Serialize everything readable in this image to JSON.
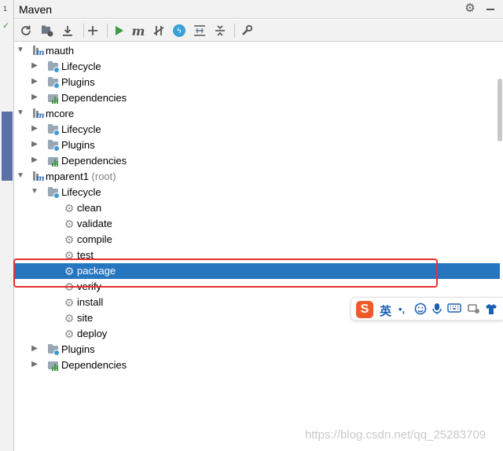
{
  "gutter": {
    "line_number": "1"
  },
  "panel": {
    "title": "Maven"
  },
  "toolbar": {
    "buttons": [
      "reload-icon",
      "generate-sources-icon",
      "download-icon",
      "add-icon",
      "run-icon",
      "execute-goal-icon",
      "toggle-offline-icon",
      "skip-tests-icon",
      "show-dependencies-icon",
      "collapse-all-icon",
      "settings-wrench-icon"
    ]
  },
  "tree": {
    "modules": [
      {
        "name": "mauth",
        "suffix": "",
        "children": [
          "Lifecycle",
          "Plugins",
          "Dependencies"
        ]
      },
      {
        "name": "mcore",
        "suffix": "",
        "children": [
          "Lifecycle",
          "Plugins",
          "Dependencies"
        ]
      },
      {
        "name": "mparent1",
        "suffix": "(root)",
        "lifecycle_label": "Lifecycle",
        "plugins_label": "Plugins",
        "dependencies_label": "Dependencies",
        "goals": [
          "clean",
          "validate",
          "compile",
          "test",
          "package",
          "verify",
          "install",
          "site",
          "deploy"
        ],
        "selected_goal": "package"
      }
    ]
  },
  "ime": {
    "logo": "S",
    "mode": "英",
    "punct": "•,",
    "items": [
      "emoji-icon",
      "microphone-icon",
      "keyboard-icon",
      "tools-icon",
      "shirt-icon"
    ]
  },
  "watermark": "https://blog.csdn.net/qq_25283709",
  "colors": {
    "selection": "#2675bf",
    "highlight_box": "#e53030",
    "run_green": "#3b9b46"
  }
}
